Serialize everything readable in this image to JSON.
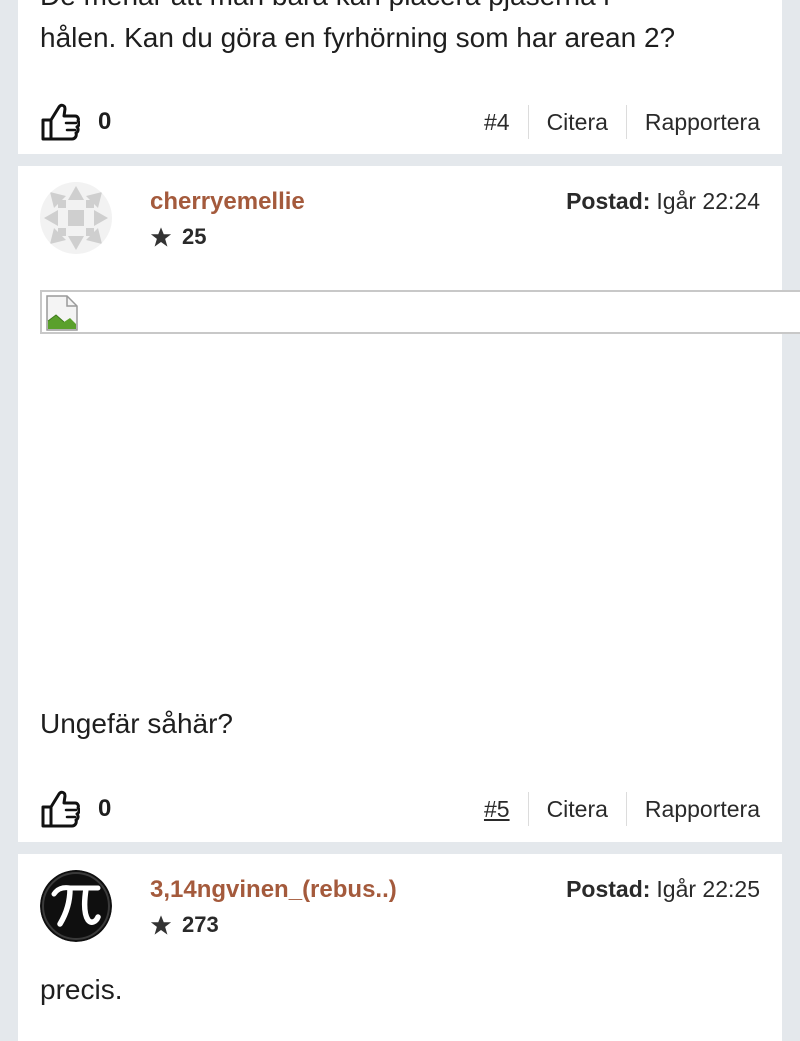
{
  "post4": {
    "text_cut": "De menar att man bara kan placera pjäserna i",
    "text": "hålen. Kan du göra en fyrhörning som har arean 2?",
    "likes": "0",
    "number": "#4",
    "quote": "Citera",
    "report": "Rapportera"
  },
  "post5": {
    "username": "cherryemellie",
    "rank": "25",
    "posted_label": "Postad:",
    "posted_time": "Igår 22:24",
    "text": "Ungefär såhär?",
    "likes": "0",
    "number": "#5",
    "quote": "Citera",
    "report": "Rapportera"
  },
  "post6": {
    "username": "3,14ngvinen_(rebus..)",
    "rank": "273",
    "posted_label": "Postad:",
    "posted_time": "Igår 22:25",
    "text": "precis."
  },
  "icons": {
    "like": "thumbs-up-icon",
    "rank": "star-icon",
    "broken_image": "broken-image-icon"
  },
  "colors": {
    "background": "#e4e8ec",
    "card": "#ffffff",
    "username": "#a45a3c",
    "text": "#1e1e1e"
  }
}
